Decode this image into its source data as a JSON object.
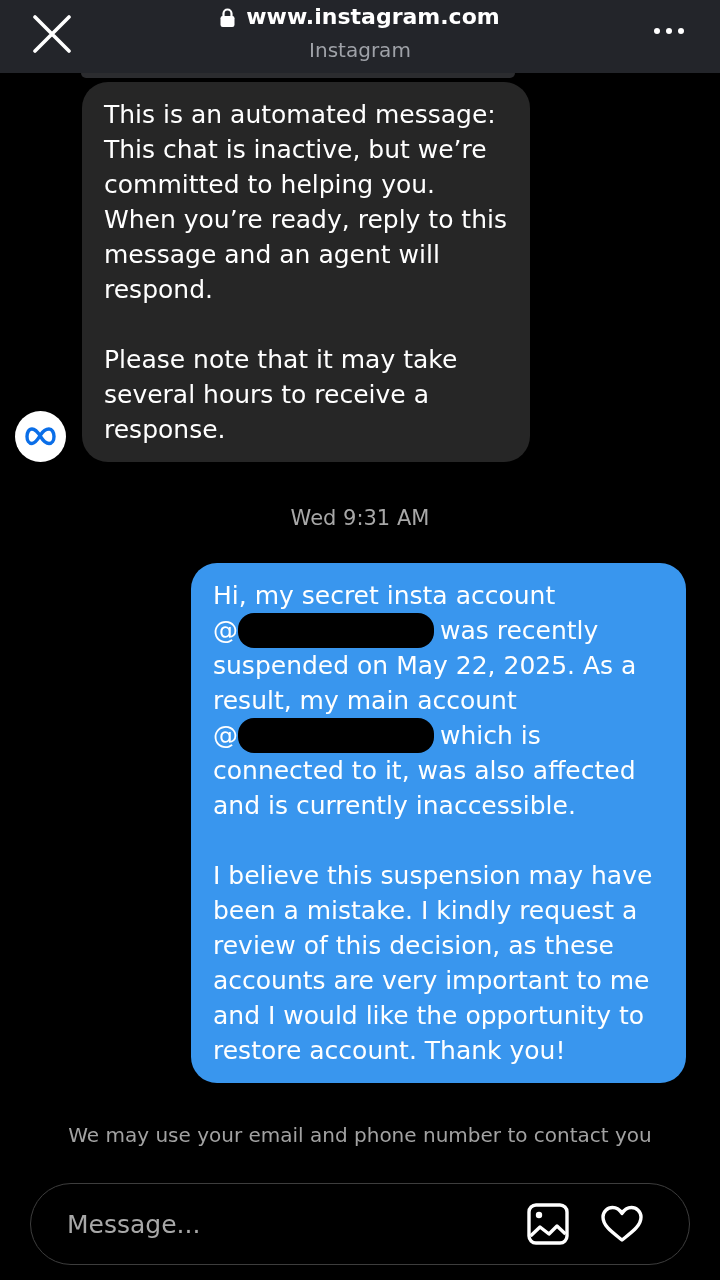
{
  "browser_bar": {
    "url": "www.instagram.com",
    "site_name": "Instagram"
  },
  "messages": [
    {
      "kind": "clipped"
    },
    {
      "kind": "incoming",
      "paragraphs": [
        {
          "segments": [
            {
              "kind": "text",
              "text": "This is an automated message: This chat is inactive, but we’re committed to helping you.\nWhen you’re ready, reply to this message and an agent will respond."
            }
          ]
        },
        {
          "segments": [
            {
              "kind": "text",
              "text": "Please note that it may take several hours to receive a response."
            }
          ]
        }
      ]
    },
    {
      "kind": "timestamp",
      "text": "Wed 9:31 AM"
    },
    {
      "kind": "outgoing",
      "paragraphs": [
        {
          "segments": [
            {
              "kind": "text",
              "text": "Hi, my secret insta account @"
            },
            {
              "kind": "redaction"
            },
            {
              "kind": "text",
              "text": "was recently suspended on May 22, 2025. As a result, my main account @"
            },
            {
              "kind": "redaction"
            },
            {
              "kind": "text",
              "text": "which is connected to it, was also affected and is currently inaccessible."
            }
          ]
        },
        {
          "segments": [
            {
              "kind": "text",
              "text": "I believe this suspension may have been a mistake. I kindly request a review of this decision, as these accounts are very important to me and I would like the opportunity to restore account. Thank you!"
            }
          ]
        }
      ]
    }
  ],
  "notice": "We may use your email and phone number to contact you",
  "composer": {
    "placeholder": "Message..."
  }
}
